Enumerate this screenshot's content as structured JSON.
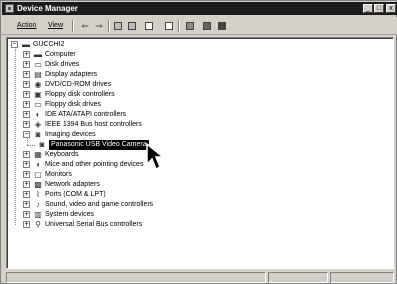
{
  "window": {
    "title": "Device Manager",
    "controls": {
      "minimize": "_",
      "maximize": "□",
      "close": "x"
    }
  },
  "menu": {
    "action": "Action",
    "view": "View"
  },
  "toolbar": {
    "icons": [
      "back-arrow-icon",
      "forward-arrow-icon",
      "up-folder-icon",
      "properties-icon",
      "print-icon",
      "help-icon",
      "scan-icon",
      "update-icon",
      "remove-icon"
    ],
    "back_glyph": "⇐",
    "forward_glyph": "⇒"
  },
  "tree": {
    "root": {
      "label": "GUCCHI2",
      "icon": "computer-icon",
      "expanded": true
    },
    "items": [
      {
        "label": "Computer",
        "icon": "computer-icon",
        "expanded": false
      },
      {
        "label": "Disk drives",
        "icon": "disk-drive-icon",
        "expanded": false
      },
      {
        "label": "Display adapters",
        "icon": "display-adapter-icon",
        "expanded": false
      },
      {
        "label": "DVD/CD-ROM drives",
        "icon": "cdrom-icon",
        "expanded": false
      },
      {
        "label": "Floppy disk controllers",
        "icon": "floppy-controller-icon",
        "expanded": false
      },
      {
        "label": "Floppy disk drives",
        "icon": "floppy-drive-icon",
        "expanded": false
      },
      {
        "label": "IDE ATA/ATAPI controllers",
        "icon": "ide-controller-icon",
        "expanded": false
      },
      {
        "label": "IEEE 1394 Bus host controllers",
        "icon": "ieee1394-icon",
        "expanded": false
      },
      {
        "label": "Imaging devices",
        "icon": "camera-icon",
        "expanded": true,
        "children": [
          {
            "label": "Panasonic USB Video Camera",
            "icon": "camera-icon",
            "selected": true
          }
        ]
      },
      {
        "label": "Keyboards",
        "icon": "keyboard-icon",
        "expanded": false
      },
      {
        "label": "Mice and other pointing devices",
        "icon": "mouse-icon",
        "expanded": false
      },
      {
        "label": "Monitors",
        "icon": "monitor-icon",
        "expanded": false
      },
      {
        "label": "Network adapters",
        "icon": "network-icon",
        "expanded": false
      },
      {
        "label": "Ports (COM & LPT)",
        "icon": "port-icon",
        "expanded": false
      },
      {
        "label": "Sound, video and game controllers",
        "icon": "sound-icon",
        "expanded": false
      },
      {
        "label": "System devices",
        "icon": "system-icon",
        "expanded": false
      },
      {
        "label": "Universal Serial Bus controllers",
        "icon": "usb-icon",
        "expanded": false
      }
    ],
    "expand_glyph": "+",
    "collapse_glyph": "−"
  },
  "status": {
    "text": ""
  }
}
